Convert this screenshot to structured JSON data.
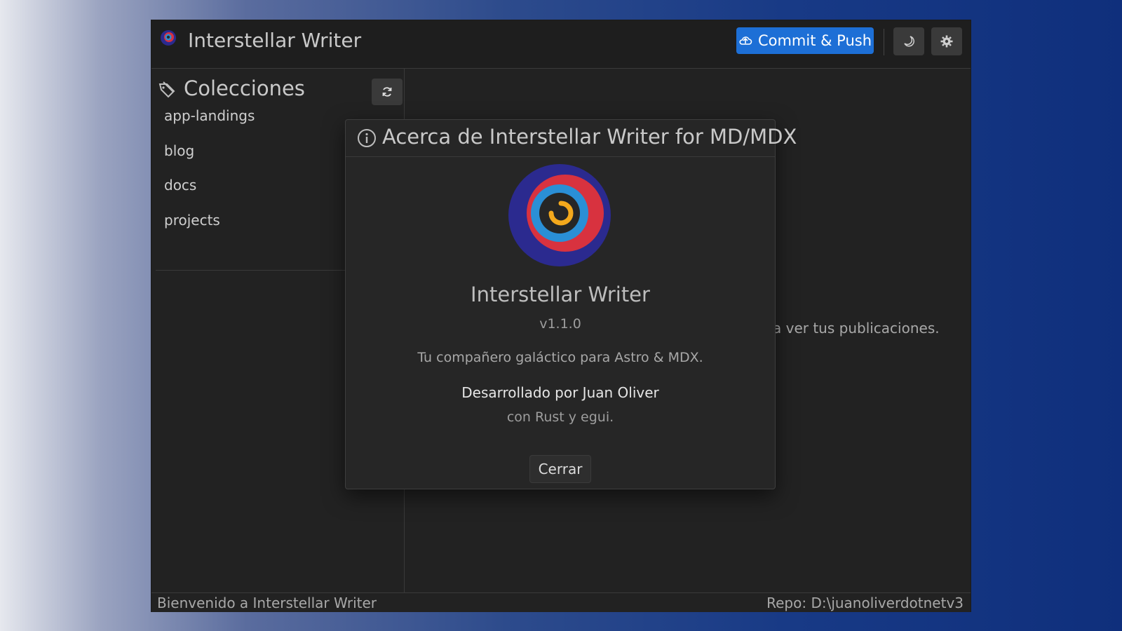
{
  "app": {
    "title": "Interstellar Writer"
  },
  "toolbar": {
    "commit_label": "Commit & Push",
    "commit_icon": "upload-cloud-icon",
    "theme_icon": "moon-icon",
    "settings_icon": "gear-icon",
    "accent": "#1d6fd6"
  },
  "sidebar": {
    "title": "Colecciones",
    "title_icon": "collections-icon",
    "refresh_icon": "refresh-icon",
    "items": [
      {
        "label": "app-landings"
      },
      {
        "label": "blog"
      },
      {
        "label": "docs"
      },
      {
        "label": "projects"
      }
    ]
  },
  "main": {
    "hint_visible_fragment": "a ver tus publicaciones."
  },
  "dialog": {
    "title": "Acerca de Interstellar Writer for MD/MDX",
    "title_icon": "info-icon",
    "app_name": "Interstellar Writer",
    "version": "v1.1.0",
    "description": "Tu compañero galáctico para Astro & MDX.",
    "developer": "Desarrollado por Juan Oliver",
    "tech": "con Rust y egui.",
    "close_label": "Cerrar"
  },
  "status": {
    "left": "Bienvenido a Interstellar Writer",
    "right": "Repo: D:\\juanoliverdotnetv3"
  }
}
